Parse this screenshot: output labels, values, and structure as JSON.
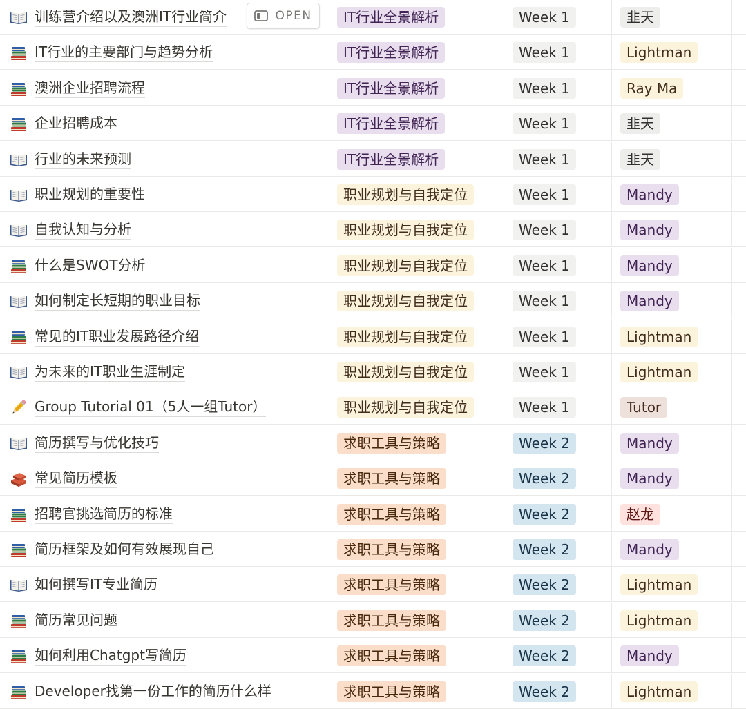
{
  "open_button": {
    "label": "OPEN",
    "icon": "side-peek-icon"
  },
  "colors": {
    "module": {
      "IT行业全景解析": {
        "bg": "#e8deee",
        "fg": "#412454"
      },
      "职业规划与自我定位": {
        "bg": "#fbf3db",
        "fg": "#402c1b"
      },
      "求职工具与策略": {
        "bg": "#fadec9",
        "fg": "#49290e"
      }
    },
    "week": {
      "Week 1": {
        "bg": "#f1f1ef",
        "fg": "#32302c"
      },
      "Week 2": {
        "bg": "#d3e5ef",
        "fg": "#183347"
      }
    },
    "tutor": {
      "韭天": {
        "bg": "#ededeb",
        "fg": "#32302c"
      },
      "Lightman": {
        "bg": "#fbf3db",
        "fg": "#402c1b"
      },
      "Ray Ma": {
        "bg": "#fbf3db",
        "fg": "#402c1b"
      },
      "Mandy": {
        "bg": "#e8deee",
        "fg": "#412454"
      },
      "Tutor": {
        "bg": "#eee0da",
        "fg": "#442a1e"
      },
      "赵龙": {
        "bg": "#ffe2dd",
        "fg": "#5d1715"
      }
    }
  },
  "rows": [
    {
      "icon": "open-book-icon",
      "title": "训练营介绍以及澳洲IT行业简介",
      "module": "IT行业全景解析",
      "week": "Week 1",
      "tutor": "韭天"
    },
    {
      "icon": "books-stack-icon",
      "title": "IT行业的主要部门与趋势分析",
      "module": "IT行业全景解析",
      "week": "Week 1",
      "tutor": "Lightman"
    },
    {
      "icon": "books-stack-icon",
      "title": "澳洲企业招聘流程",
      "module": "IT行业全景解析",
      "week": "Week 1",
      "tutor": "Ray Ma"
    },
    {
      "icon": "books-stack-icon",
      "title": "企业招聘成本",
      "module": "IT行业全景解析",
      "week": "Week 1",
      "tutor": "韭天"
    },
    {
      "icon": "open-book-icon",
      "title": "行业的未来预测",
      "module": "IT行业全景解析",
      "week": "Week 1",
      "tutor": "韭天"
    },
    {
      "icon": "open-book-icon",
      "title": "职业规划的重要性",
      "module": "职业规划与自我定位",
      "week": "Week 1",
      "tutor": "Mandy"
    },
    {
      "icon": "open-book-icon",
      "title": "自我认知与分析",
      "module": "职业规划与自我定位",
      "week": "Week 1",
      "tutor": "Mandy"
    },
    {
      "icon": "books-stack-icon",
      "title": "什么是SWOT分析",
      "module": "职业规划与自我定位",
      "week": "Week 1",
      "tutor": "Mandy"
    },
    {
      "icon": "open-book-icon",
      "title": "如何制定长短期的职业目标",
      "module": "职业规划与自我定位",
      "week": "Week 1",
      "tutor": "Mandy"
    },
    {
      "icon": "books-stack-icon",
      "title": "常见的IT职业发展路径介绍",
      "module": "职业规划与自我定位",
      "week": "Week 1",
      "tutor": "Lightman"
    },
    {
      "icon": "open-book-icon",
      "title": "为未来的IT职业生涯制定",
      "module": "职业规划与自我定位",
      "week": "Week 1",
      "tutor": "Lightman"
    },
    {
      "icon": "pencil-icon",
      "title": "Group Tutorial 01（5人一组Tutor）",
      "module": "职业规划与自我定位",
      "week": "Week 1",
      "tutor": "Tutor"
    },
    {
      "icon": "open-book-icon",
      "title": "简历撰写与优化技巧",
      "module": "求职工具与策略",
      "week": "Week 2",
      "tutor": "Mandy"
    },
    {
      "icon": "bricks-icon",
      "title": "常见简历模板",
      "module": "求职工具与策略",
      "week": "Week 2",
      "tutor": "Mandy"
    },
    {
      "icon": "books-stack-icon",
      "title": "招聘官挑选简历的标准",
      "module": "求职工具与策略",
      "week": "Week 2",
      "tutor": "赵龙"
    },
    {
      "icon": "books-stack-icon",
      "title": "简历框架及如何有效展现自己",
      "module": "求职工具与策略",
      "week": "Week 2",
      "tutor": "Mandy"
    },
    {
      "icon": "open-book-icon",
      "title": "如何撰写IT专业简历",
      "module": "求职工具与策略",
      "week": "Week 2",
      "tutor": "Lightman"
    },
    {
      "icon": "books-stack-icon",
      "title": "简历常见问题",
      "module": "求职工具与策略",
      "week": "Week 2",
      "tutor": "Lightman"
    },
    {
      "icon": "books-stack-icon",
      "title": "如何利用Chatgpt写简历",
      "module": "求职工具与策略",
      "week": "Week 2",
      "tutor": "Mandy"
    },
    {
      "icon": "books-stack-icon",
      "title": "Developer找第一份工作的简历什么样",
      "module": "求职工具与策略",
      "week": "Week 2",
      "tutor": "Lightman"
    }
  ]
}
